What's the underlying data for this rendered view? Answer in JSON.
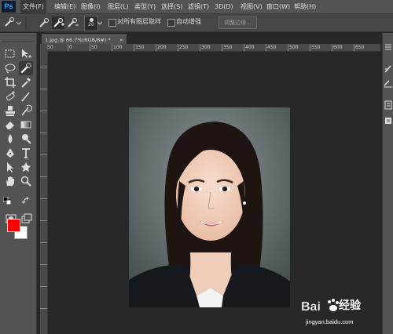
{
  "app": {
    "logo": "Ps"
  },
  "menu": [
    "文件(F)",
    "编辑(E)",
    "图像(I)",
    "图层(L)",
    "类型(Y)",
    "选择(S)",
    "滤镜(T)",
    "3D(D)",
    "视图(V)",
    "窗口(W)",
    "帮助(H)"
  ],
  "options": {
    "brush_size": "20",
    "sample_all_layers": "对所有图层取样",
    "auto_enhance": "自动增强",
    "refine_edge": "调整边缘..."
  },
  "document": {
    "tab_title": "1.jpg @ 66.7%(RGB/8#) *",
    "close": "×"
  },
  "ruler": {
    "h_labels": [
      "50",
      "0",
      "50",
      "100",
      "150",
      "200",
      "250",
      "300",
      "350",
      "400",
      "450",
      "500",
      "550",
      "600",
      "650"
    ]
  },
  "colors": {
    "foreground": "#ff0000",
    "background": "#ffffff"
  },
  "watermark": {
    "brand": "Bai",
    "brand2": "经验",
    "url": "jingyan.baidu.com"
  }
}
